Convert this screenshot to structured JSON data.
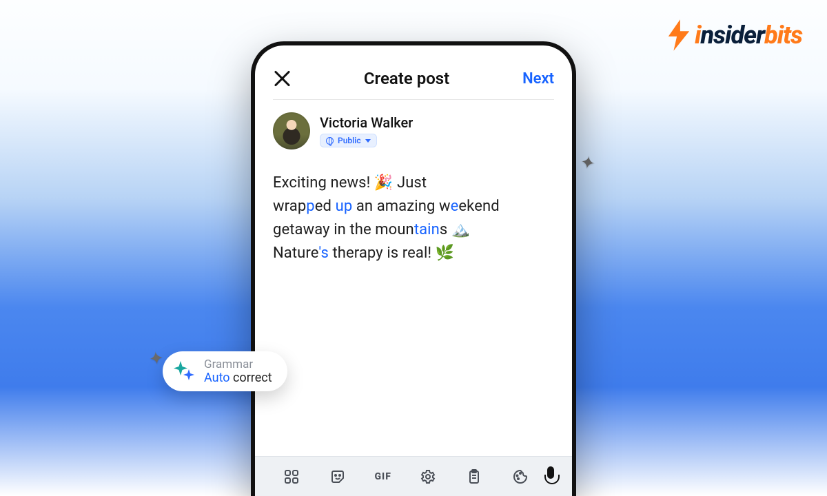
{
  "brand": {
    "name": "insiderbits"
  },
  "header": {
    "title": "Create post",
    "next_label": "Next"
  },
  "author": {
    "name": "Victoria Walker",
    "privacy_label": "Public"
  },
  "post": {
    "line1_a": "Exciting news! ",
    "line1_emoji": "🎉",
    "line1_b": " Just",
    "line2_a": "wrap",
    "line2_hl1": "p",
    "line2_b": "ed ",
    "line2_hl2": "up",
    "line2_c": " an amazing w",
    "line2_hl3": "e",
    "line2_d": "ekend",
    "line3_a": "getaway in the moun",
    "line3_hl1": "tain",
    "line3_b": "s ",
    "line3_emoji": "🏔️",
    "line4_a": "Nature",
    "line4_hl1": "'s",
    "line4_b": " therapy is real! ",
    "line4_emoji": "🌿"
  },
  "pill": {
    "line1": "Grammar",
    "line2_auto": "Auto",
    "line2_rest": " correct"
  },
  "keyboard": {
    "gif_label": "GIF"
  }
}
